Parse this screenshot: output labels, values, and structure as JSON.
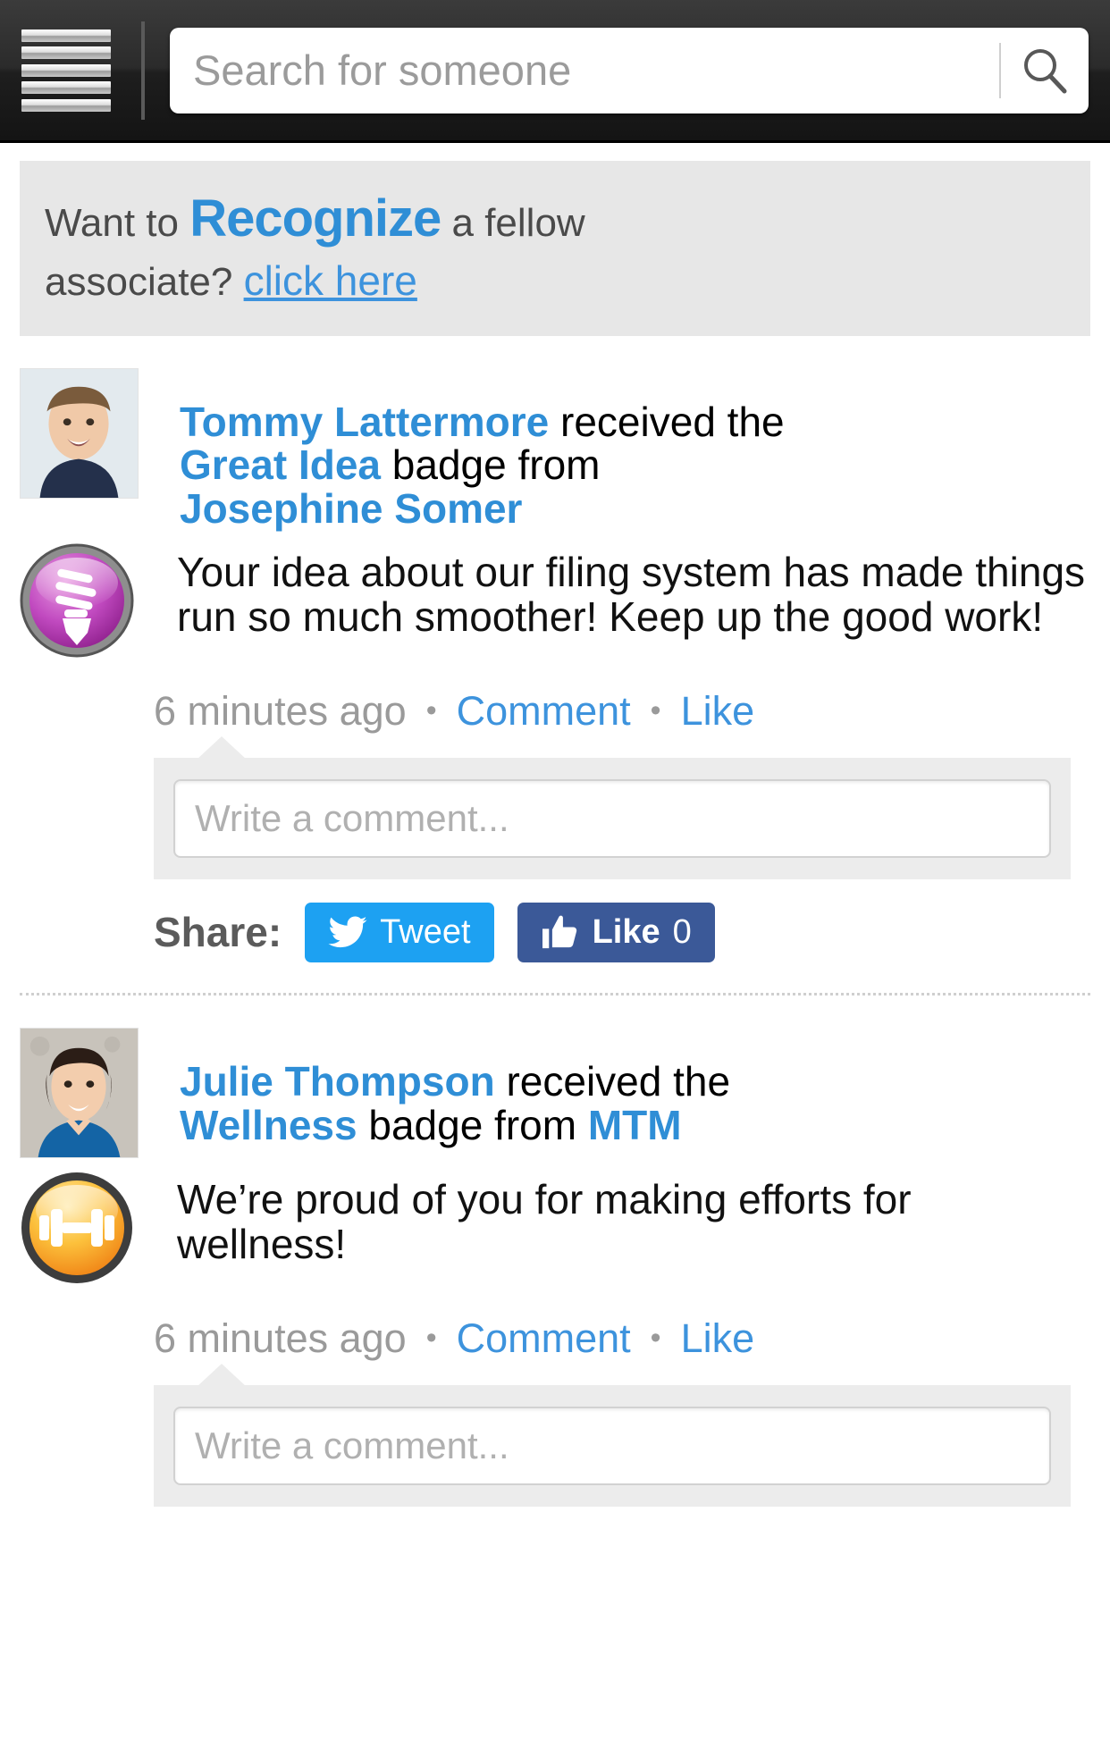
{
  "header": {
    "menu_icon": "hamburger-menu-icon",
    "search": {
      "placeholder": "Search for someone",
      "value": "",
      "icon": "search-icon"
    }
  },
  "promo": {
    "lead": "Want to ",
    "strong": "Recognize",
    "mid": " a fellow",
    "tail": "associate? ",
    "link": "click here"
  },
  "posts": [
    {
      "avatar_name": "tommy-lattermore-avatar",
      "recipient": "Tommy Lattermore",
      "received_text": " received the",
      "badge_name": "Great Idea",
      "badge_mid": " badge from",
      "giver": "Josephine Somer",
      "badge_icon": "lightbulb-badge-icon",
      "badge_color": "#b03fb0",
      "message": "Your idea about our filing system has made things run so much smoother! Keep up the good work!",
      "timestamp": "6 minutes ago",
      "dot": "•",
      "comment_label": "Comment",
      "like_label": "Like",
      "comment_placeholder": "Write a comment...",
      "comment_value": "",
      "share_label": "Share:",
      "tweet_label": "Tweet",
      "tweet_icon": "twitter-bird-icon",
      "fb_like_label": "Like",
      "fb_like_count": "0",
      "fb_like_icon": "thumbs-up-icon"
    },
    {
      "avatar_name": "julie-thompson-avatar",
      "recipient": "Julie Thompson",
      "received_text": " received the",
      "badge_name": "Wellness",
      "badge_mid": " badge from ",
      "giver": "MTM",
      "badge_icon": "dumbbell-badge-icon",
      "badge_color": "#f6a41c",
      "message": "We’re proud of you for making efforts for wellness!",
      "timestamp": "6 minutes ago",
      "dot": "•",
      "comment_label": "Comment",
      "like_label": "Like",
      "comment_placeholder": "Write a comment...",
      "comment_value": ""
    }
  ],
  "colors": {
    "link_blue": "#2f8ed6",
    "twitter_blue": "#1da1f2",
    "facebook_blue": "#3b5998",
    "header_dark": "#222222",
    "promo_bg": "#e7e7e7"
  }
}
